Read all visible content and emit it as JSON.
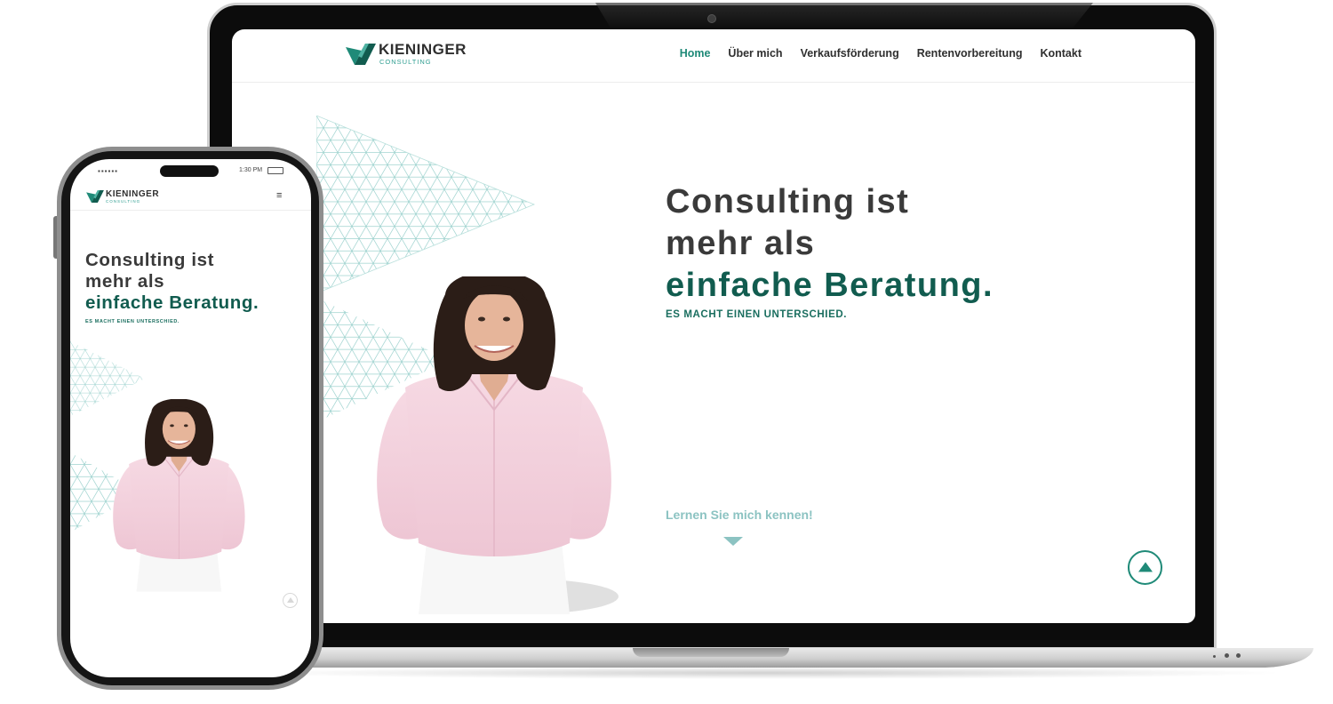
{
  "brand": {
    "name": "KIENINGER",
    "sub": "CONSULTING",
    "accent": "#1f8a78",
    "dark_green": "#115c4f",
    "cta_color": "#8cc3c2"
  },
  "nav": {
    "items": [
      "Home",
      "Über mich",
      "Verkaufsförderung",
      "Rentenvorbereitung",
      "Kontakt"
    ],
    "active_index": 0
  },
  "hero": {
    "line1": "Consulting ist",
    "line2": "mehr als",
    "line3": "einfache Beratung.",
    "tagline": "ES MACHT EINEN UNTERSCHIED.",
    "cta": "Lernen Sie mich kennen!"
  },
  "phone": {
    "status_time": "1:30 PM",
    "menu_icon": "hamburger-icon"
  },
  "icons": {
    "scroll_top": "arrow-up-circle-icon",
    "scroll_down": "triangle-down-icon",
    "logo": "kieninger-logo-mark"
  }
}
